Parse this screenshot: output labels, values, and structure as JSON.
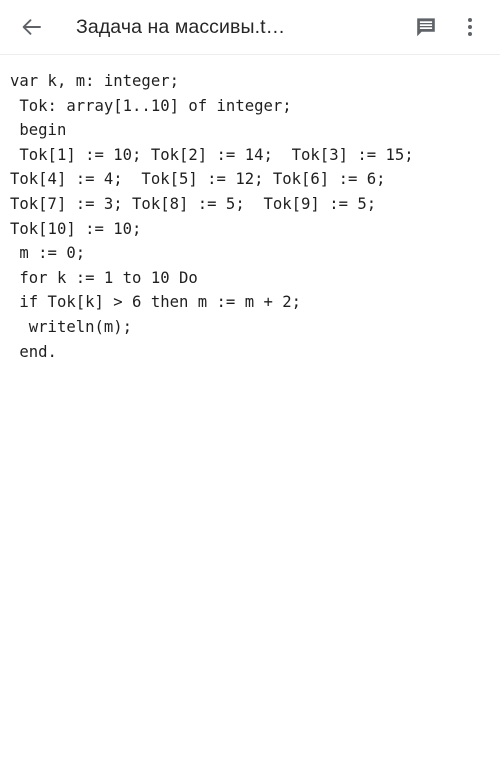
{
  "appbar": {
    "back_icon": "arrow-left-icon",
    "title": "Задача на массивы.t…",
    "comment_icon": "comment-bubble-icon",
    "overflow_icon": "more-vertical-icon",
    "title_color": "#262626",
    "icon_color": "#5f6368"
  },
  "document": {
    "language": "pascal",
    "text_color": "#1f1f1f",
    "background": "#ffffff",
    "lines": [
      "var k, m: integer;",
      " Tok: array[1..10] of integer;",
      " begin",
      " Tok[1] := 10; Tok[2] := 14;  Tok[3] := 15;",
      "Tok[4] := 4;  Tok[5] := 12; Tok[6] := 6;",
      "Tok[7] := 3; Tok[8] := 5;  Tok[9] := 5;",
      "Tok[10] := 10;",
      " m := 0;",
      " for k := 1 to 10 Do",
      " if Tok[k] > 6 then m := m + 2;",
      "  writeln(m);",
      " end."
    ],
    "content": "var k, m: integer;\n Tok: array[1..10] of integer;\n begin\n Tok[1] := 10; Tok[2] := 14;  Tok[3] := 15;\nTok[4] := 4;  Tok[5] := 12; Tok[6] := 6;\nTok[7] := 3; Tok[8] := 5;  Tok[9] := 5;\nTok[10] := 10;\n m := 0;\n for k := 1 to 10 Do\n if Tok[k] > 6 then m := m + 2;\n  writeln(m);\n end."
  }
}
